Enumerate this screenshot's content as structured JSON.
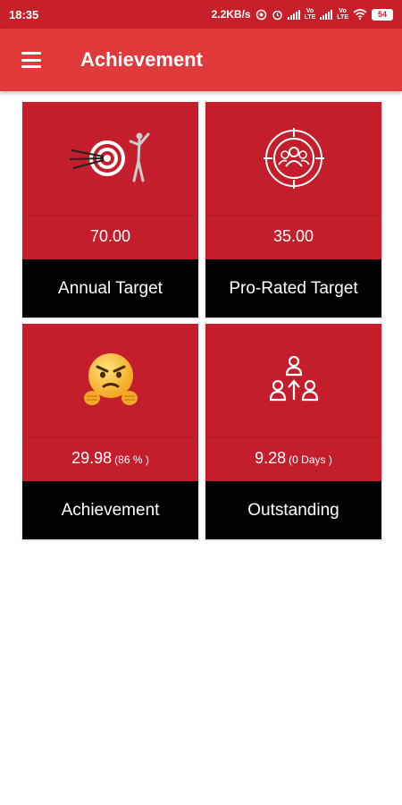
{
  "status_bar": {
    "time": "18:35",
    "speed": "2.2KB/s",
    "battery": "54"
  },
  "app_bar": {
    "title": "Achievement"
  },
  "cards": [
    {
      "icon": "target-archer-icon",
      "value": "70.00",
      "detail": "",
      "label": "Annual Target"
    },
    {
      "icon": "group-target-icon",
      "value": "35.00",
      "detail": "",
      "label": "Pro-Rated Target"
    },
    {
      "icon": "angry-emoji-icon",
      "value": "29.98",
      "detail": "(86 % )",
      "label": "Achievement"
    },
    {
      "icon": "hierarchy-people-icon",
      "value": "9.28",
      "detail": "(0 Days )",
      "label": "Outstanding"
    }
  ],
  "colors": {
    "status_bar": "#c8202a",
    "app_bar": "#e03a3a",
    "card_top": "#c41e2c",
    "card_label": "#000000"
  }
}
